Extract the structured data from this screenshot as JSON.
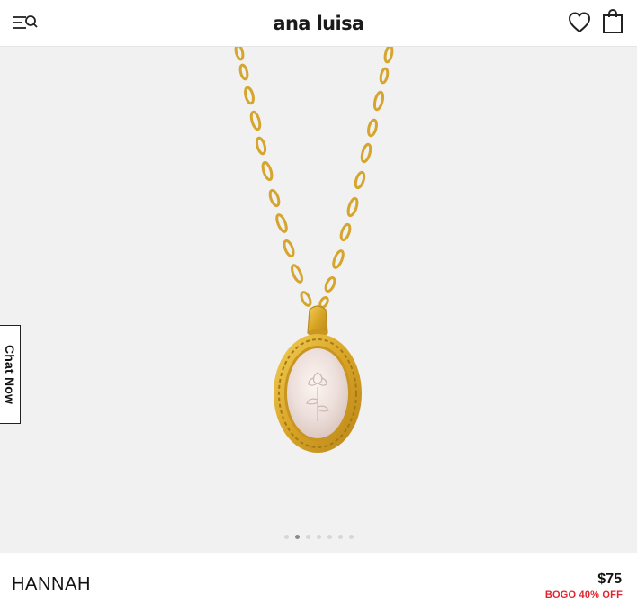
{
  "header": {
    "brand": "ana luisa"
  },
  "icons": {
    "menu": "menu-search-icon",
    "wishlist": "heart-icon",
    "bag": "shopping-bag-icon"
  },
  "chat": {
    "label": "Chat Now"
  },
  "gallery": {
    "image_count": 7,
    "active_index": 1
  },
  "product": {
    "name": "HANNAH",
    "price": "$75",
    "promo": "BOGO 40% OFF"
  },
  "colors": {
    "gold": "#d9a62a",
    "promo_red": "#e0242f",
    "gallery_bg": "#f1f1f1"
  }
}
